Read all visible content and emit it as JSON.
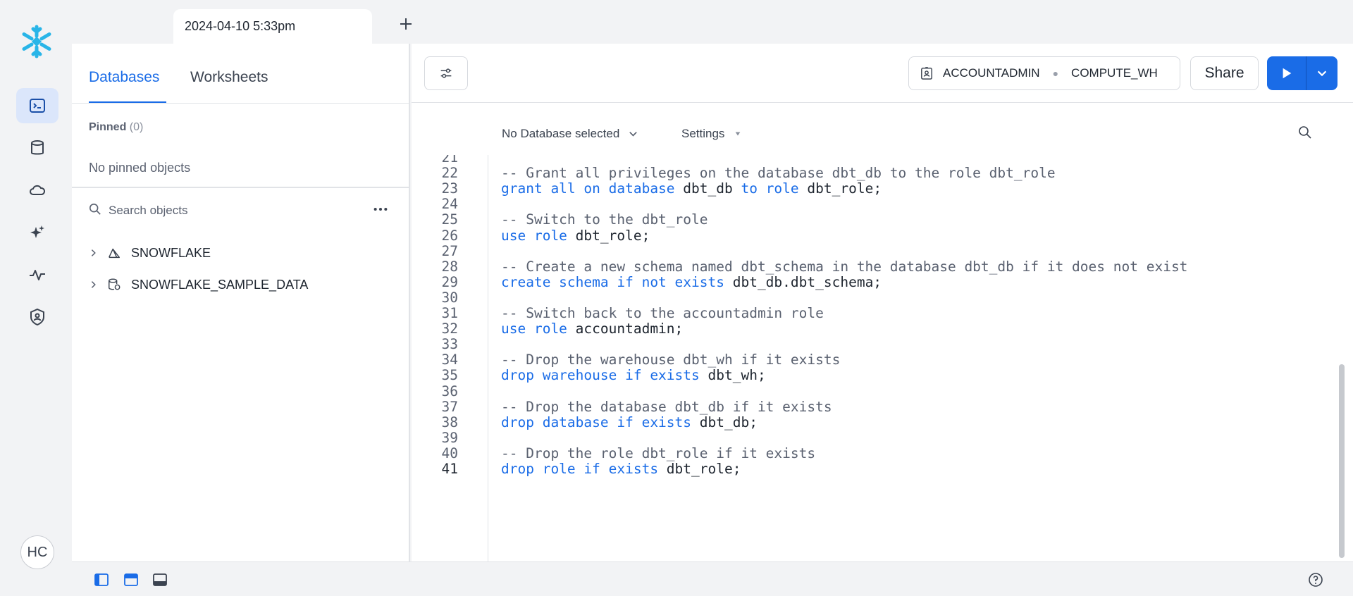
{
  "tab": {
    "label": "2024-04-10 5:33pm",
    "new_tab_glyph": "+"
  },
  "user": {
    "initials": "HC"
  },
  "left_panel": {
    "tabs": [
      {
        "label": "Databases",
        "active": true
      },
      {
        "label": "Worksheets",
        "active": false
      }
    ],
    "pinned_label": "Pinned",
    "pinned_count": "(0)",
    "no_pinned": "No pinned objects",
    "search_placeholder": "Search objects",
    "tree": [
      {
        "label": "SNOWFLAKE",
        "icon": "shared-database-icon"
      },
      {
        "label": "SNOWFLAKE_SAMPLE_DATA",
        "icon": "sample-database-icon"
      }
    ]
  },
  "editor": {
    "role": "ACCOUNTADMIN",
    "warehouse": "COMPUTE_WH",
    "share_label": "Share",
    "database_select": "No Database selected",
    "settings_label": "Settings",
    "current_line": "41",
    "lines": [
      {
        "n": "21",
        "segments": []
      },
      {
        "n": "22",
        "segments": [
          {
            "t": "-- Grant all privileges on the database dbt_db to the role dbt_role",
            "c": "cmt"
          }
        ]
      },
      {
        "n": "23",
        "segments": [
          {
            "t": "grant all on database",
            "c": "kw"
          },
          {
            "t": " dbt_db ",
            "c": "plain"
          },
          {
            "t": "to role",
            "c": "kw"
          },
          {
            "t": " dbt_role;",
            "c": "plain"
          }
        ]
      },
      {
        "n": "24",
        "segments": []
      },
      {
        "n": "25",
        "segments": [
          {
            "t": "-- Switch to the dbt_role",
            "c": "cmt"
          }
        ]
      },
      {
        "n": "26",
        "segments": [
          {
            "t": "use role",
            "c": "kw"
          },
          {
            "t": " dbt_role;",
            "c": "plain"
          }
        ]
      },
      {
        "n": "27",
        "segments": []
      },
      {
        "n": "28",
        "segments": [
          {
            "t": "-- Create a new schema named dbt_schema in the database dbt_db if it does not exist",
            "c": "cmt"
          }
        ]
      },
      {
        "n": "29",
        "segments": [
          {
            "t": "create schema if not exists",
            "c": "kw"
          },
          {
            "t": " dbt_db.dbt_schema;",
            "c": "plain"
          }
        ]
      },
      {
        "n": "30",
        "segments": []
      },
      {
        "n": "31",
        "segments": [
          {
            "t": "-- Switch back to the accountadmin role",
            "c": "cmt"
          }
        ]
      },
      {
        "n": "32",
        "segments": [
          {
            "t": "use role",
            "c": "kw"
          },
          {
            "t": " accountadmin;",
            "c": "plain"
          }
        ]
      },
      {
        "n": "33",
        "segments": []
      },
      {
        "n": "34",
        "segments": [
          {
            "t": "-- Drop the warehouse dbt_wh if it exists",
            "c": "cmt"
          }
        ]
      },
      {
        "n": "35",
        "segments": [
          {
            "t": "drop warehouse if exists",
            "c": "kw"
          },
          {
            "t": " dbt_wh;",
            "c": "plain"
          }
        ]
      },
      {
        "n": "36",
        "segments": []
      },
      {
        "n": "37",
        "segments": [
          {
            "t": "-- Drop the database dbt_db if it exists",
            "c": "cmt"
          }
        ]
      },
      {
        "n": "38",
        "segments": [
          {
            "t": "drop database if exists",
            "c": "kw"
          },
          {
            "t": " dbt_db;",
            "c": "plain"
          }
        ]
      },
      {
        "n": "39",
        "segments": []
      },
      {
        "n": "40",
        "segments": [
          {
            "t": "-- Drop the role dbt_role if it exists",
            "c": "cmt"
          }
        ]
      },
      {
        "n": "41",
        "segments": [
          {
            "t": "drop role if exists",
            "c": "kw"
          },
          {
            "t": " dbt_role;",
            "c": "plain"
          }
        ]
      }
    ]
  },
  "colors": {
    "accent": "#1a6ce7",
    "brand_logo": "#29b5e8",
    "comment": "#5a6170",
    "keyword": "#1a6ce7"
  }
}
